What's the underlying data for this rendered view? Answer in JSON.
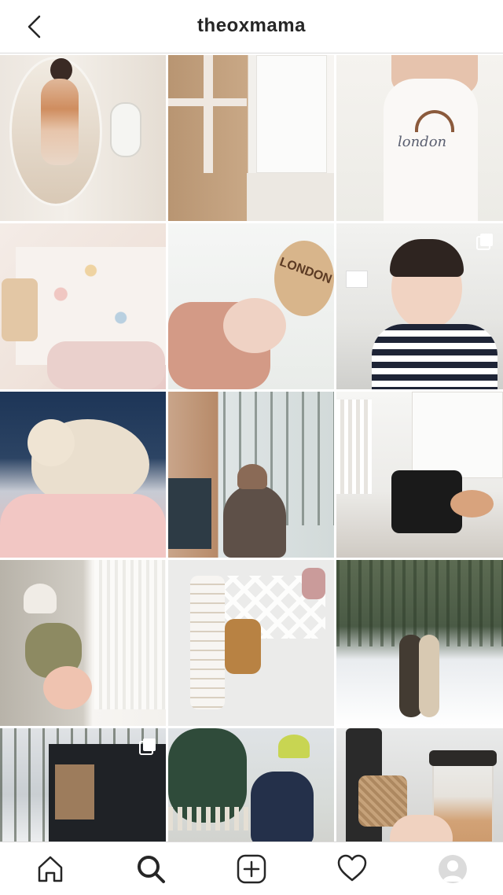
{
  "header": {
    "title": "theoxmama",
    "back_icon": "chevron-left-icon"
  },
  "grid": {
    "columns": 3,
    "posts": [
      {
        "index": 1,
        "kind": "photo",
        "multi": false
      },
      {
        "index": 2,
        "kind": "photo",
        "multi": false
      },
      {
        "index": 3,
        "kind": "photo",
        "multi": false,
        "visible_text": "london"
      },
      {
        "index": 4,
        "kind": "photo",
        "multi": false
      },
      {
        "index": 5,
        "kind": "photo",
        "multi": false,
        "visible_text": "LONDON"
      },
      {
        "index": 6,
        "kind": "photo",
        "multi": true
      },
      {
        "index": 7,
        "kind": "photo",
        "multi": false
      },
      {
        "index": 8,
        "kind": "photo",
        "multi": false
      },
      {
        "index": 9,
        "kind": "photo",
        "multi": false
      },
      {
        "index": 10,
        "kind": "photo",
        "multi": false
      },
      {
        "index": 11,
        "kind": "photo",
        "multi": false
      },
      {
        "index": 12,
        "kind": "photo",
        "multi": false
      },
      {
        "index": 13,
        "kind": "photo",
        "multi": true
      },
      {
        "index": 14,
        "kind": "photo",
        "multi": false
      },
      {
        "index": 15,
        "kind": "photo",
        "multi": false
      }
    ]
  },
  "bottom_nav": {
    "items": [
      {
        "icon": "home-icon",
        "active": false
      },
      {
        "icon": "search-icon",
        "active": true
      },
      {
        "icon": "add-post-icon",
        "active": false
      },
      {
        "icon": "heart-icon",
        "active": false
      },
      {
        "icon": "profile-avatar-icon",
        "active": false
      }
    ]
  },
  "colors": {
    "text": "#262626",
    "border": "#dbdbdb",
    "background": "#ffffff"
  }
}
